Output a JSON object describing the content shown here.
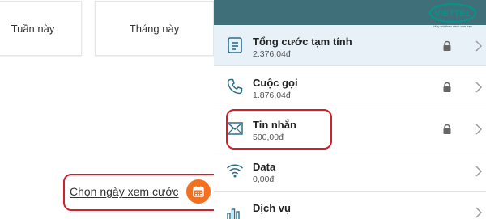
{
  "filters": {
    "week_label": "Tuần này",
    "month_label": "Tháng này"
  },
  "date_picker": {
    "label": "Chọn ngày xem cước",
    "icon": "calendar-icon",
    "accent": "#f37021"
  },
  "brand": {
    "name": "VIETTEL",
    "tagline": "Hãy nói theo cách của bạn",
    "color": "#009688"
  },
  "charges": [
    {
      "title": "Tổng cước tạm tính",
      "amount": "2.376,04đ",
      "icon": "document-icon",
      "locked": true
    },
    {
      "title": "Cuộc gọi",
      "amount": "1.876,04đ",
      "icon": "phone-icon",
      "locked": true
    },
    {
      "title": "Tin nhắn",
      "amount": "500,00đ",
      "icon": "envelope-icon",
      "locked": true
    },
    {
      "title": "Data",
      "amount": "0,00đ",
      "icon": "wifi-icon",
      "locked": false
    },
    {
      "title": "Dịch vụ",
      "amount": "",
      "icon": "bar-chart-icon",
      "locked": false
    }
  ],
  "colors": {
    "highlight_border": "#d0202a",
    "header": "#3f6f78",
    "icon": "#2a6f8a"
  }
}
